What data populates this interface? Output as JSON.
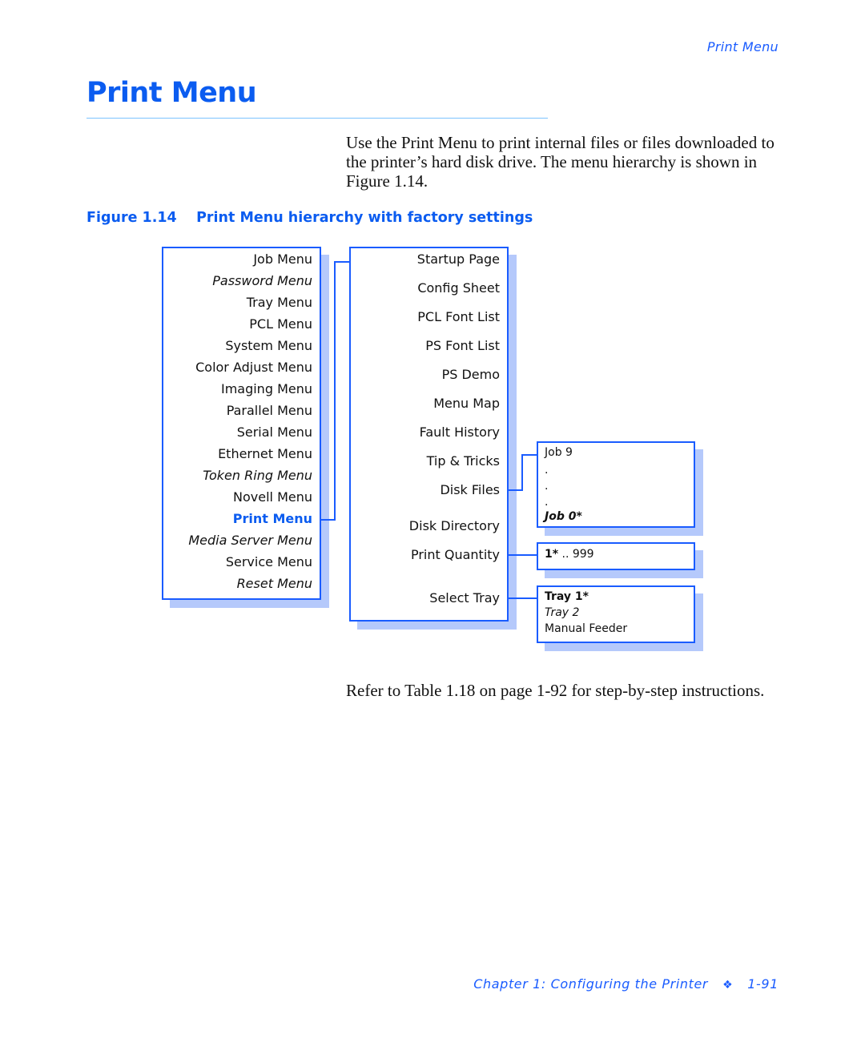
{
  "running_head": "Print Menu",
  "page_title": "Print Menu",
  "intro_text": "Use the Print Menu to print internal files or files downloaded to the printer’s hard disk drive. The menu hierarchy is shown in Figure 1.14.",
  "figure": {
    "number": "Figure 1.14",
    "caption": "Print Menu hierarchy with factory settings",
    "main_menu": [
      {
        "label": "Job Menu",
        "style": "normal"
      },
      {
        "label": "Password Menu",
        "style": "italic"
      },
      {
        "label": "Tray Menu",
        "style": "normal"
      },
      {
        "label": "PCL Menu",
        "style": "normal"
      },
      {
        "label": "System Menu",
        "style": "normal"
      },
      {
        "label": "Color Adjust Menu",
        "style": "normal"
      },
      {
        "label": "Imaging Menu",
        "style": "normal"
      },
      {
        "label": "Parallel Menu",
        "style": "normal"
      },
      {
        "label": "Serial Menu",
        "style": "normal"
      },
      {
        "label": "Ethernet Menu",
        "style": "normal"
      },
      {
        "label": "Token Ring Menu",
        "style": "italic"
      },
      {
        "label": "Novell Menu",
        "style": "normal"
      },
      {
        "label": "Print Menu",
        "style": "active"
      },
      {
        "label": "Media Server Menu",
        "style": "italic"
      },
      {
        "label": "Service Menu",
        "style": "normal"
      },
      {
        "label": "Reset Menu",
        "style": "italic"
      }
    ],
    "print_menu_items": [
      "Startup Page",
      "Config Sheet",
      "PCL Font List",
      "PS Font List",
      "PS Demo",
      "Menu Map",
      "Fault History",
      "Tip & Tricks",
      "Disk Files",
      "Disk Directory",
      "Print Quantity",
      "Select Tray"
    ],
    "disk_files_options": [
      {
        "label": "Job 9",
        "style": "normal"
      },
      {
        "label": ".",
        "style": "normal"
      },
      {
        "label": ".",
        "style": "normal"
      },
      {
        "label": ".",
        "style": "normal"
      },
      {
        "label": "Job 0*",
        "style": "bolditalic"
      }
    ],
    "print_quantity_options": {
      "default": "1*",
      "rest": " .. 999"
    },
    "select_tray_options": [
      {
        "label": "Tray 1*",
        "style": "bold"
      },
      {
        "label": "Tray 2",
        "style": "italic"
      },
      {
        "label": "Manual Feeder",
        "style": "normal"
      }
    ]
  },
  "refer_text": "Refer to Table 1.18 on page 1-92 for step-by-step instructions.",
  "footer": {
    "chapter": "Chapter 1: Configuring the Printer",
    "separator_icon": "❖",
    "page_number": "1-91"
  }
}
